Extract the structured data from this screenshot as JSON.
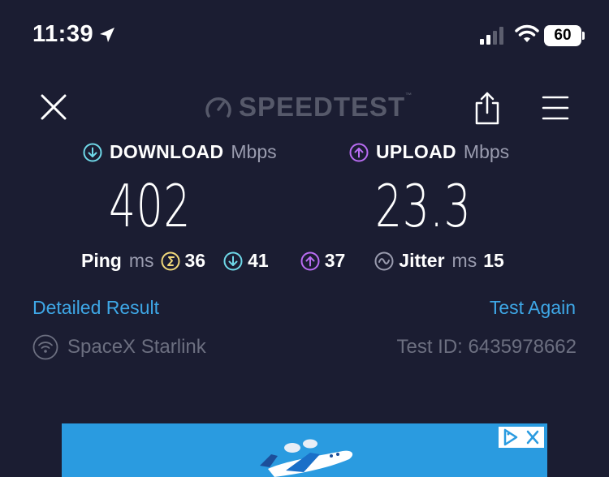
{
  "status_bar": {
    "time": "11:39",
    "battery": "60"
  },
  "header": {
    "brand": "SPEEDTEST",
    "icons": [
      "close-icon",
      "speedometer-icon",
      "share-icon",
      "menu-icon"
    ]
  },
  "download": {
    "label": "DOWNLOAD",
    "unit": "Mbps",
    "value": "402"
  },
  "upload": {
    "label": "UPLOAD",
    "unit": "Mbps",
    "value": "23.3"
  },
  "ping": {
    "label": "Ping",
    "unit": "ms",
    "idle": "36",
    "download": "41",
    "upload": "37"
  },
  "jitter": {
    "label": "Jitter",
    "unit": "ms",
    "value": "15"
  },
  "actions": {
    "detailed": "Detailed Result",
    "again": "Test Again"
  },
  "provider": {
    "name": "SpaceX Starlink",
    "test_id": "Test ID: 6435978662"
  },
  "colors": {
    "background": "#1b1d32",
    "download_accent": "#6fd8e8",
    "upload_accent": "#b96cf2",
    "link": "#3ea7e6",
    "idle_ping": "#f0d87a"
  }
}
